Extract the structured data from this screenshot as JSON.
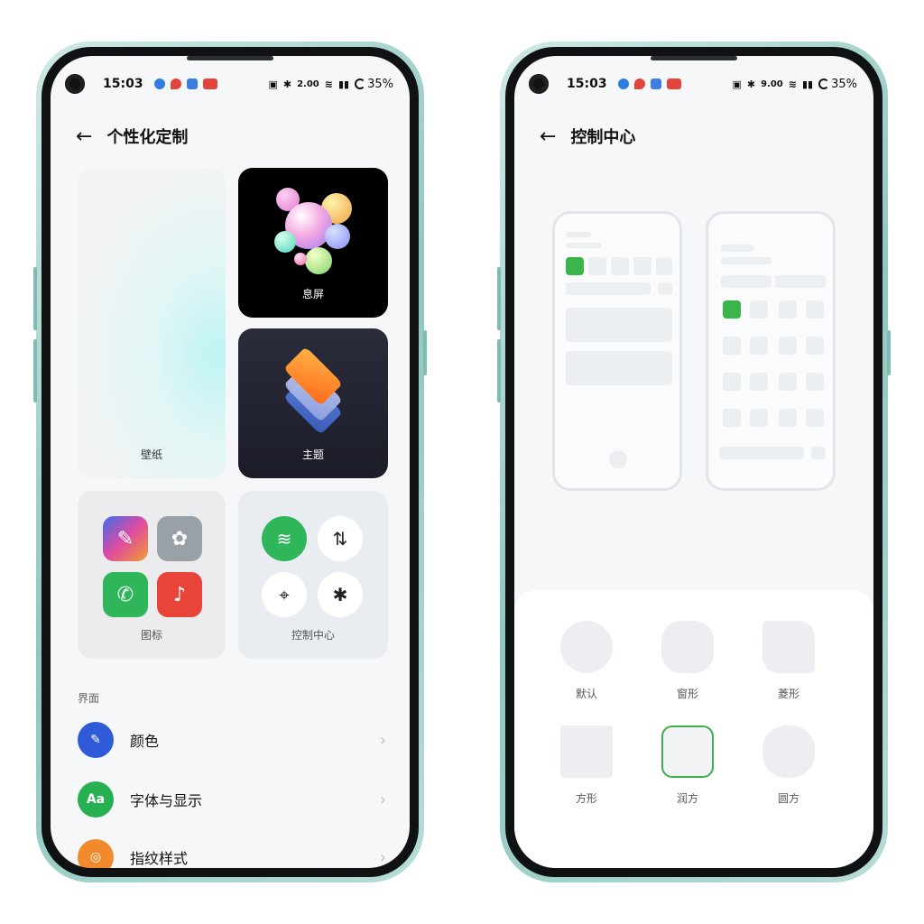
{
  "statusbar": {
    "time": "15:03",
    "speed_left": "2.00",
    "speed_right": "9.00",
    "speed_unit": "KB/S",
    "battery": "35%"
  },
  "left": {
    "title": "个性化定制",
    "tiles": {
      "wallpaper": "壁纸",
      "aod": "息屏",
      "theme": "主题",
      "icons": "图标",
      "control_center": "控制中心"
    },
    "section_title": "界面",
    "list": [
      {
        "label": "颜色",
        "icon": "brush-icon",
        "color": "#2f5bd8"
      },
      {
        "label": "字体与显示",
        "icon": "font-icon",
        "color": "#27b052"
      },
      {
        "label": "指纹样式",
        "icon": "fingerprint-icon",
        "color": "#f08a2c"
      }
    ]
  },
  "right": {
    "title": "控制中心",
    "shapes": [
      {
        "label": "默认",
        "selected": false
      },
      {
        "label": "窗形",
        "selected": false
      },
      {
        "label": "菱形",
        "selected": false
      },
      {
        "label": "方形",
        "selected": false
      },
      {
        "label": "润方",
        "selected": true
      },
      {
        "label": "圆方",
        "selected": false
      }
    ]
  },
  "colors": {
    "accent_green": "#39b54a",
    "selected_border": "#3cae4a"
  }
}
